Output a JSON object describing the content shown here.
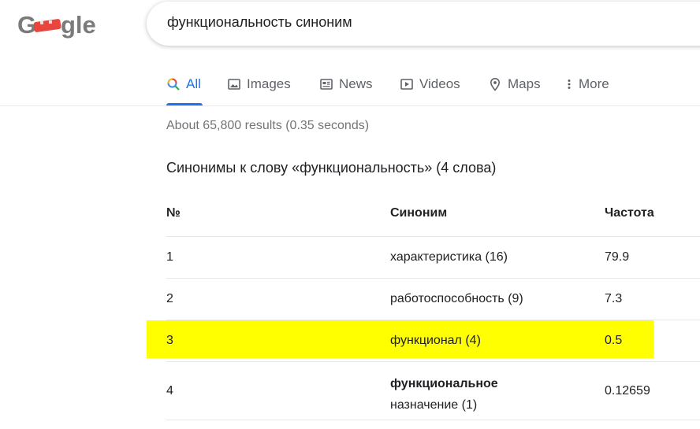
{
  "logo": {
    "text": "Google"
  },
  "search": {
    "query": "функциональность синоним"
  },
  "tabs": [
    {
      "label": "All",
      "icon": "search-icon",
      "active": true
    },
    {
      "label": "Images",
      "icon": "image-icon"
    },
    {
      "label": "News",
      "icon": "news-icon"
    },
    {
      "label": "Videos",
      "icon": "video-icon"
    },
    {
      "label": "Maps",
      "icon": "map-pin-icon"
    },
    {
      "label": "More",
      "icon": "more-vert-icon"
    }
  ],
  "result_stats": "About 65,800 results (0.35 seconds)",
  "synonyms": {
    "heading": "Синонимы к слову «функциональность» (4 слова)",
    "columns": [
      "№",
      "Синоним",
      "Частота"
    ],
    "rows": [
      {
        "num": "1",
        "synonym": "характеристика (16)",
        "freq": "79.9"
      },
      {
        "num": "2",
        "synonym": "работоспособность (9)",
        "freq": "7.3"
      },
      {
        "num": "3",
        "synonym": "функционал (4)",
        "freq": "0.5",
        "highlighted": true
      },
      {
        "num": "4",
        "synonym_bold": "функциональное",
        "synonym_rest": "назначение (1)",
        "freq": "0.12659"
      }
    ]
  },
  "colors": {
    "accent": "#1a73e8",
    "tab_inactive": "#5f6368",
    "stats": "#70757a",
    "highlight": "#ffff00"
  }
}
